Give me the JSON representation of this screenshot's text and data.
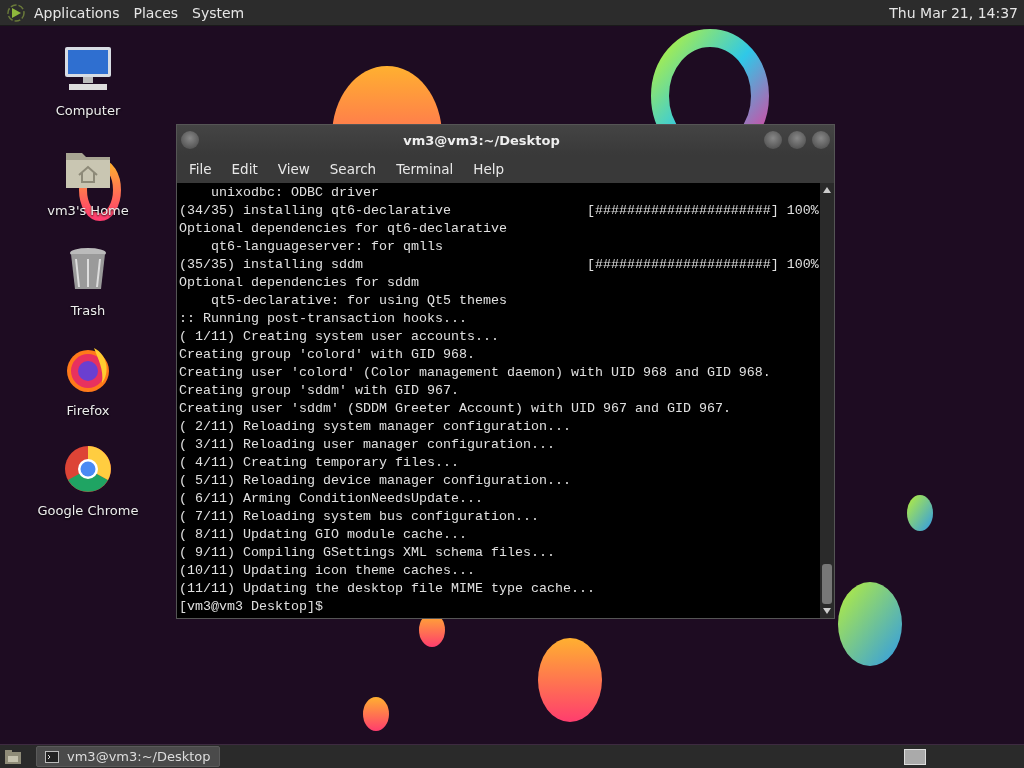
{
  "top_panel": {
    "menus": [
      "Applications",
      "Places",
      "System"
    ],
    "clock": "Thu Mar 21, 14:37"
  },
  "desktop_icons": [
    {
      "label": "Computer",
      "kind": "computer"
    },
    {
      "label": "vm3's Home",
      "kind": "home"
    },
    {
      "label": "Trash",
      "kind": "trash"
    },
    {
      "label": "Firefox",
      "kind": "firefox"
    },
    {
      "label": "Google Chrome",
      "kind": "chrome"
    }
  ],
  "terminal": {
    "title": "vm3@vm3:~/Desktop",
    "menu": [
      "File",
      "Edit",
      "View",
      "Search",
      "Terminal",
      "Help"
    ],
    "lines": [
      "    unixodbc: ODBC driver",
      "(34/35) installing qt6-declarative                 [######################] 100%",
      "Optional dependencies for qt6-declarative",
      "    qt6-languageserver: for qmlls",
      "(35/35) installing sddm                            [######################] 100%",
      "Optional dependencies for sddm",
      "    qt5-declarative: for using Qt5 themes",
      ":: Running post-transaction hooks...",
      "( 1/11) Creating system user accounts...",
      "Creating group 'colord' with GID 968.",
      "Creating user 'colord' (Color management daemon) with UID 968 and GID 968.",
      "Creating group 'sddm' with GID 967.",
      "Creating user 'sddm' (SDDM Greeter Account) with UID 967 and GID 967.",
      "( 2/11) Reloading system manager configuration...",
      "( 3/11) Reloading user manager configuration...",
      "( 4/11) Creating temporary files...",
      "( 5/11) Reloading device manager configuration...",
      "( 6/11) Arming ConditionNeedsUpdate...",
      "( 7/11) Reloading system bus configuration...",
      "( 8/11) Updating GIO module cache...",
      "( 9/11) Compiling GSettings XML schema files...",
      "(10/11) Updating icon theme caches...",
      "(11/11) Updating the desktop file MIME type cache..."
    ],
    "prompt": "[vm3@vm3 Desktop]$"
  },
  "taskbar": {
    "tasks": [
      {
        "label": "vm3@vm3:~/Desktop",
        "selected": true
      }
    ]
  }
}
